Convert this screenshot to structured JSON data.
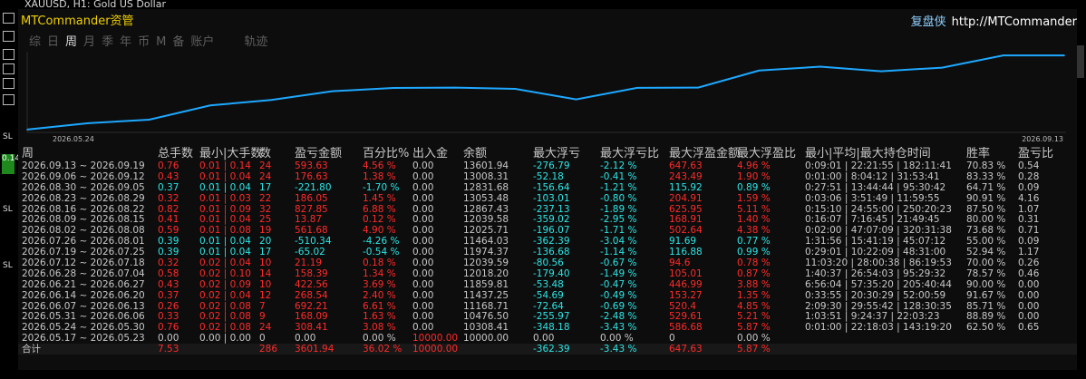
{
  "window": {
    "title": "XAUUSD, H1: Gold US Dollar"
  },
  "sidebar": {
    "sl_label": "SL",
    "buy_mark": "0.14"
  },
  "panel": {
    "title": "MTCommander资管",
    "brand_cn": "复盘侠",
    "brand_url": "http://MTCommander"
  },
  "tabs": [
    {
      "label": "综",
      "active": false
    },
    {
      "label": "日",
      "active": false
    },
    {
      "label": "周",
      "active": true
    },
    {
      "label": "月",
      "active": false
    },
    {
      "label": "季",
      "active": false
    },
    {
      "label": "年",
      "active": false
    },
    {
      "label": "币",
      "active": false
    },
    {
      "label": "M",
      "active": false
    },
    {
      "label": "备",
      "active": false
    },
    {
      "label": "账户",
      "active": false
    },
    {
      "label": "轨迹",
      "active": false
    }
  ],
  "chart_data": {
    "type": "line",
    "x_start_label": "2026.05.24",
    "x_end_label": "2026.09.13",
    "color": "#1ea8ff",
    "x": [
      "2026.05.17",
      "2026.05.24",
      "2026.05.31",
      "2026.06.07",
      "2026.06.14",
      "2026.06.21",
      "2026.06.28",
      "2026.07.05",
      "2026.07.12",
      "2026.07.19",
      "2026.07.26",
      "2026.08.02",
      "2026.08.09",
      "2026.08.16",
      "2026.08.23",
      "2026.08.30",
      "2026.09.06",
      "2026.09.13"
    ],
    "values": [
      10000.0,
      10308.41,
      10476.5,
      11168.71,
      11437.25,
      11859.81,
      12018.2,
      12039.59,
      11974.37,
      11464.03,
      12025.71,
      12039.58,
      12867.43,
      13053.48,
      12831.68,
      13008.31,
      13601.94,
      13601.94
    ],
    "ylim": [
      9950,
      13650
    ]
  },
  "table": {
    "headers": {
      "period": "周",
      "trades": "总手数",
      "lots": "最小|大手数",
      "count": "数",
      "pnl": "盈亏金额",
      "pct": "百分比%",
      "dep": "出入金",
      "bal": "余额",
      "fl": "最大浮亏",
      "flp": "最大浮亏比",
      "fp": "最大浮盈金额",
      "fpp": "最大浮盈比",
      "hold": "最小|平均|最大持仓时间",
      "win": "胜率",
      "pf": "盈亏比"
    },
    "rows": [
      {
        "period": "2026.09.13 ~ 2026.09.19",
        "trades": "0.76",
        "lots": "0.01 | 0.14",
        "count": "24",
        "pnl": "593.63",
        "pct": "4.56 %",
        "dep": "0.00",
        "bal": "13601.94",
        "fl": "-276.79",
        "flp": "-2.12 %",
        "fp": "647.63",
        "fpp": "4.96 %",
        "hold": "0:09:01 | 22:21:55 | 182:11:41",
        "win": "70.83 %",
        "pf": "0.54",
        "tone": "red"
      },
      {
        "period": "2026.09.06 ~ 2026.09.12",
        "trades": "0.43",
        "lots": "0.01 | 0.04",
        "count": "24",
        "pnl": "176.63",
        "pct": "1.38 %",
        "dep": "0.00",
        "bal": "13008.31",
        "fl": "-52.18",
        "flp": "-0.41 %",
        "fp": "243.49",
        "fpp": "1.90 %",
        "hold": "0:01:00 | 8:04:12 | 31:53:41",
        "win": "83.33 %",
        "pf": "0.28",
        "tone": "red"
      },
      {
        "period": "2026.08.30 ~ 2026.09.05",
        "trades": "0.37",
        "lots": "0.01 | 0.04",
        "count": "17",
        "pnl": "-221.80",
        "pct": "-1.70 %",
        "dep": "0.00",
        "bal": "12831.68",
        "fl": "-156.64",
        "flp": "-1.21 %",
        "fp": "115.92",
        "fpp": "0.89 %",
        "hold": "0:27:51 | 13:44:44 | 95:30:42",
        "win": "64.71 %",
        "pf": "0.09",
        "tone": "cyan"
      },
      {
        "period": "2026.08.23 ~ 2026.08.29",
        "trades": "0.32",
        "lots": "0.01 | 0.03",
        "count": "22",
        "pnl": "186.05",
        "pct": "1.45 %",
        "dep": "0.00",
        "bal": "13053.48",
        "fl": "-103.01",
        "flp": "-0.80 %",
        "fp": "204.91",
        "fpp": "1.59 %",
        "hold": "0:03:06 | 3:51:49 | 11:59:55",
        "win": "90.91 %",
        "pf": "4.16",
        "tone": "red"
      },
      {
        "period": "2026.08.16 ~ 2026.08.22",
        "trades": "0.82",
        "lots": "0.01 | 0.09",
        "count": "32",
        "pnl": "827.85",
        "pct": "6.88 %",
        "dep": "0.00",
        "bal": "12867.43",
        "fl": "-237.13",
        "flp": "-1.89 %",
        "fp": "625.95",
        "fpp": "5.11 %",
        "hold": "0:15:10 | 24:55:00 | 250:20:23",
        "win": "87.50 %",
        "pf": "1.07",
        "tone": "red"
      },
      {
        "period": "2026.08.09 ~ 2026.08.15",
        "trades": "0.41",
        "lots": "0.01 | 0.04",
        "count": "25",
        "pnl": "13.87",
        "pct": "0.12 %",
        "dep": "0.00",
        "bal": "12039.58",
        "fl": "-359.02",
        "flp": "-2.95 %",
        "fp": "168.91",
        "fpp": "1.40 %",
        "hold": "0:16:07 | 7:16:45 | 21:49:45",
        "win": "80.00 %",
        "pf": "0.31",
        "tone": "red"
      },
      {
        "period": "2026.08.02 ~ 2026.08.08",
        "trades": "0.59",
        "lots": "0.01 | 0.08",
        "count": "19",
        "pnl": "561.68",
        "pct": "4.90 %",
        "dep": "0.00",
        "bal": "12025.71",
        "fl": "-196.07",
        "flp": "-1.71 %",
        "fp": "502.64",
        "fpp": "4.38 %",
        "hold": "0:02:00 | 47:07:09 | 320:31:38",
        "win": "73.68 %",
        "pf": "0.71",
        "tone": "red"
      },
      {
        "period": "2026.07.26 ~ 2026.08.01",
        "trades": "0.39",
        "lots": "0.01 | 0.04",
        "count": "20",
        "pnl": "-510.34",
        "pct": "-4.26 %",
        "dep": "0.00",
        "bal": "11464.03",
        "fl": "-362.39",
        "flp": "-3.04 %",
        "fp": "91.69",
        "fpp": "0.77 %",
        "hold": "1:31:56 | 15:41:19 | 45:07:12",
        "win": "55.00 %",
        "pf": "0.09",
        "tone": "cyan"
      },
      {
        "period": "2026.07.19 ~ 2026.07.25",
        "trades": "0.39",
        "lots": "0.01 | 0.04",
        "count": "17",
        "pnl": "-65.02",
        "pct": "-0.54 %",
        "dep": "0.00",
        "bal": "11974.37",
        "fl": "-136.68",
        "flp": "-1.14 %",
        "fp": "116.88",
        "fpp": "0.99 %",
        "hold": "0:29:01 | 10:22:09 | 48:31:00",
        "win": "52.94 %",
        "pf": "1.17",
        "tone": "cyan"
      },
      {
        "period": "2026.07.12 ~ 2026.07.18",
        "trades": "0.32",
        "lots": "0.02 | 0.04",
        "count": "10",
        "pnl": "21.19",
        "pct": "0.18 %",
        "dep": "0.00",
        "bal": "12039.59",
        "fl": "-80.56",
        "flp": "-0.67 %",
        "fp": "94.6",
        "fpp": "0.78 %",
        "hold": "11:03:20 | 28:00:38 | 86:19:53",
        "win": "70.00 %",
        "pf": "0.26",
        "tone": "red"
      },
      {
        "period": "2026.06.28 ~ 2026.07.04",
        "trades": "0.58",
        "lots": "0.02 | 0.10",
        "count": "14",
        "pnl": "158.39",
        "pct": "1.34 %",
        "dep": "0.00",
        "bal": "12018.20",
        "fl": "-179.40",
        "flp": "-1.49 %",
        "fp": "105.01",
        "fpp": "0.87 %",
        "hold": "1:40:37 | 26:54:03 | 95:29:32",
        "win": "78.57 %",
        "pf": "0.46",
        "tone": "red"
      },
      {
        "period": "2026.06.21 ~ 2026.06.27",
        "trades": "0.43",
        "lots": "0.02 | 0.09",
        "count": "10",
        "pnl": "422.56",
        "pct": "3.69 %",
        "dep": "0.00",
        "bal": "11859.81",
        "fl": "-53.48",
        "flp": "-0.47 %",
        "fp": "446.99",
        "fpp": "3.88 %",
        "hold": "6:56:04 | 57:35:20 | 205:40:44",
        "win": "90.00 %",
        "pf": "0.00",
        "tone": "red"
      },
      {
        "period": "2026.06.14 ~ 2026.06.20",
        "trades": "0.37",
        "lots": "0.02 | 0.04",
        "count": "12",
        "pnl": "268.54",
        "pct": "2.40 %",
        "dep": "0.00",
        "bal": "11437.25",
        "fl": "-54.69",
        "flp": "-0.49 %",
        "fp": "153.27",
        "fpp": "1.35 %",
        "hold": "0:33:55 | 20:30:29 | 52:00:59",
        "win": "91.67 %",
        "pf": "0.00",
        "tone": "red"
      },
      {
        "period": "2026.06.07 ~ 2026.06.13",
        "trades": "0.26",
        "lots": "0.02 | 0.08",
        "count": "7",
        "pnl": "692.21",
        "pct": "6.61 %",
        "dep": "0.00",
        "bal": "11168.71",
        "fl": "-72.64",
        "flp": "-0.69 %",
        "fp": "520.4",
        "fpp": "4.85 %",
        "hold": "2:09:30 | 29:55:42 | 128:30:35",
        "win": "85.71 %",
        "pf": "0.00",
        "tone": "red"
      },
      {
        "period": "2026.05.31 ~ 2026.06.06",
        "trades": "0.33",
        "lots": "0.02 | 0.08",
        "count": "9",
        "pnl": "168.09",
        "pct": "1.63 %",
        "dep": "0.00",
        "bal": "10476.50",
        "fl": "-255.97",
        "flp": "-2.48 %",
        "fp": "529.61",
        "fpp": "5.21 %",
        "hold": "1:03:51 | 9:24:37 | 22:03:23",
        "win": "88.89 %",
        "pf": "0.00",
        "tone": "red"
      },
      {
        "period": "2026.05.24 ~ 2026.05.30",
        "trades": "0.76",
        "lots": "0.02 | 0.08",
        "count": "24",
        "pnl": "308.41",
        "pct": "3.08 %",
        "dep": "0.00",
        "bal": "10308.41",
        "fl": "-348.18",
        "flp": "-3.43 %",
        "fp": "586.68",
        "fpp": "5.87 %",
        "hold": "0:01:00 | 22:18:03 | 143:19:20",
        "win": "62.50 %",
        "pf": "0.65",
        "tone": "red"
      },
      {
        "period": "2026.05.17 ~ 2026.05.23",
        "trades": "0.00",
        "lots": "0.00 | 0.00",
        "count": "0",
        "pnl": "0.00",
        "pct": "0.00 %",
        "dep": "10000.00",
        "bal": "10000.00",
        "fl": "0.00",
        "flp": "0.00 %",
        "fp": "0",
        "fpp": "0.00 %",
        "hold": "",
        "win": "",
        "pf": "",
        "tone": "gray"
      }
    ],
    "total": {
      "period": "合计",
      "trades": "7.53",
      "lots": "",
      "count": "286",
      "pnl": "3601.94",
      "pct": "36.02 %",
      "dep": "10000.00",
      "bal": "",
      "fl": "-362.39",
      "flp": "-3.43 %",
      "fp": "647.63",
      "fpp": "5.87 %",
      "hold": "",
      "win": "",
      "pf": ""
    }
  }
}
